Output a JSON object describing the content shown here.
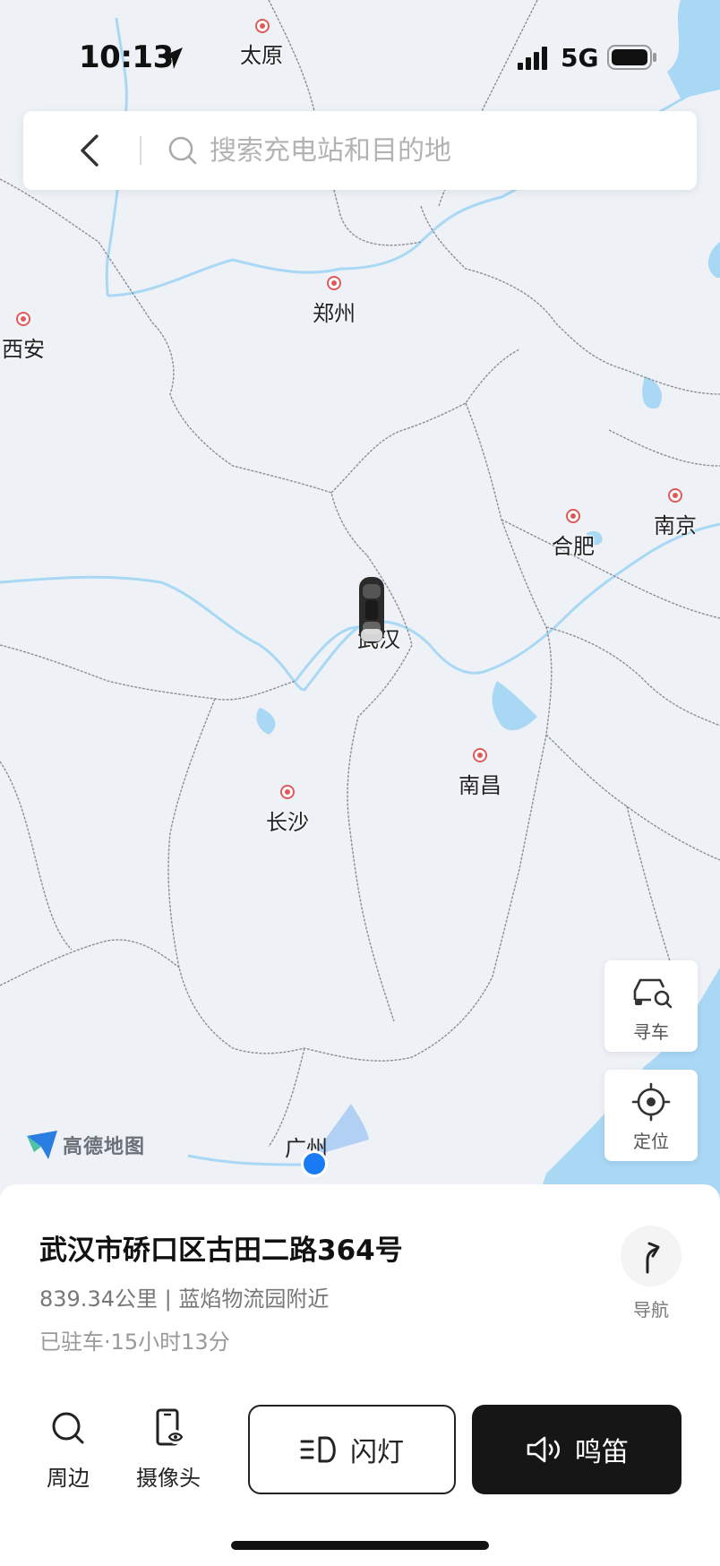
{
  "status_bar": {
    "time": "10:13",
    "network": "5G"
  },
  "search": {
    "placeholder": "搜索充电站和目的地"
  },
  "map": {
    "cities": [
      {
        "name": "太原"
      },
      {
        "name": "郑州"
      },
      {
        "name": "西安"
      },
      {
        "name": "南京"
      },
      {
        "name": "合肥"
      },
      {
        "name": "武汉"
      },
      {
        "name": "南昌"
      },
      {
        "name": "长沙"
      },
      {
        "name": "广州"
      }
    ],
    "brand": "高德地图",
    "colors": {
      "land": "#eef2f7",
      "water": "#a8d8f4",
      "border": "#8a8f98",
      "city_marker": "#e05a5a",
      "user_dot": "#1a7cf5"
    }
  },
  "controls": {
    "find_car": "寻车",
    "locate": "定位"
  },
  "vehicle": {
    "address": "武汉市硚口区古田二路364号",
    "distance_info": "839.34公里 | 蓝焰物流园附近",
    "parked_info": "已驻车·15小时13分",
    "navigate": "导航"
  },
  "actions": {
    "nearby": "周边",
    "camera": "摄像头",
    "flash": "闪灯",
    "honk": "鸣笛"
  },
  "icons": [
    "location-arrow-icon",
    "signal-icon",
    "battery-icon",
    "back-icon",
    "search-icon",
    "car-search-icon",
    "crosshair-icon",
    "turn-arrow-icon",
    "magnifier-icon",
    "phone-camera-icon",
    "headlight-icon",
    "horn-icon"
  ]
}
